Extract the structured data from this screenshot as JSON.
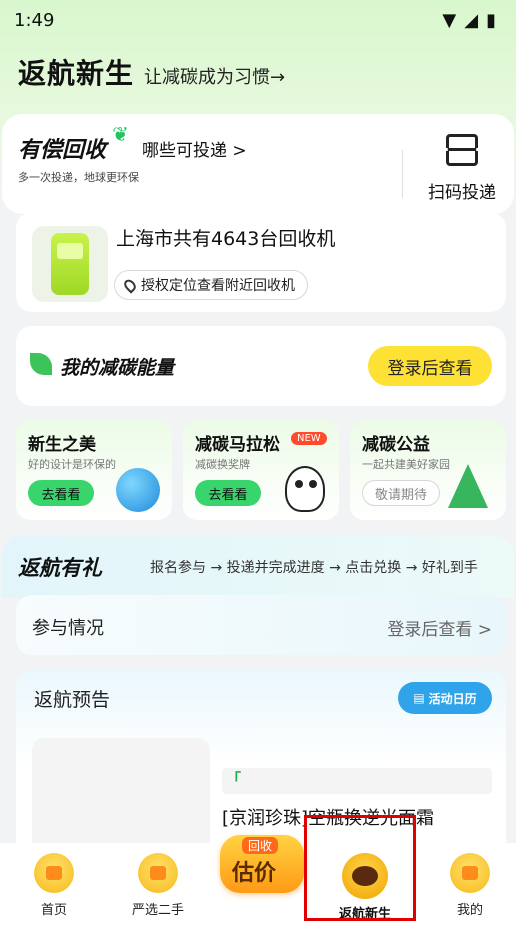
{
  "status_bar": {
    "time": "1:49"
  },
  "header": {
    "title": "返航新生",
    "subtitle": "让减碳成为习惯→"
  },
  "recycle": {
    "title": "有偿回收",
    "link": "哪些可投递 >",
    "subtitle": "多一次投递，地球更环保",
    "scan_label": "扫码投递"
  },
  "machine": {
    "text": "上海市共有4643台回收机",
    "location_btn": "授权定位查看附近回收机"
  },
  "energy": {
    "title": "我的减碳能量",
    "login_btn": "登录后查看"
  },
  "minis": [
    {
      "title": "新生之美",
      "sub": "好的设计是环保的",
      "btn": "去看看"
    },
    {
      "title": "减碳马拉松",
      "sub": "减碳换奖牌",
      "btn": "去看看",
      "badge": "NEW"
    },
    {
      "title": "减碳公益",
      "sub": "一起共建美好家园",
      "btn": "敬请期待"
    }
  ],
  "gift": {
    "title": "返航有礼",
    "steps": "报名参与 → 投递并完成进度 → 点击兑换 → 好礼到手"
  },
  "participation": {
    "label": "参与情况",
    "right": "登录后查看 >"
  },
  "preview": {
    "title": "返航预告",
    "calendar_btn": "活动日历",
    "tag": "「",
    "product": "[京润珍珠]空瓶换逆光面霜"
  },
  "tabbar": {
    "home": "首页",
    "secondhand": "严选二手",
    "price_top": "回收",
    "price_main": "估价",
    "return": "返航新生",
    "mine": "我的"
  }
}
